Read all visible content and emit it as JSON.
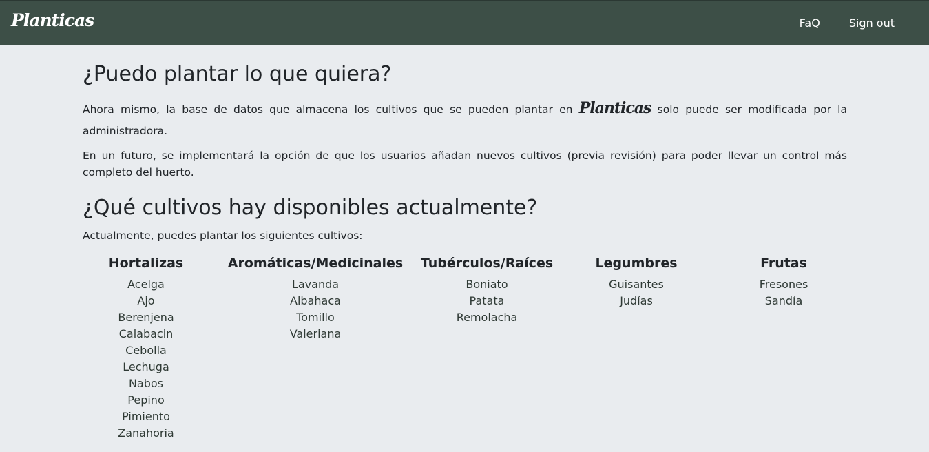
{
  "navbar": {
    "brand": "Planticas",
    "links": [
      {
        "label": "FaQ"
      },
      {
        "label": "Sign out"
      }
    ]
  },
  "main": {
    "heading1": "¿Puedo plantar lo que quiera?",
    "p1_before": "Ahora mismo, la base de datos que almacena los cultivos que se pueden plantar en ",
    "p1_brand": "Planticas",
    "p1_after": " solo puede ser modificada por la administradora.",
    "p2": "En un futuro, se implementará la opción de que los usuarios añadan nuevos cultivos (previa revisión) para poder llevar un control más completo del huerto.",
    "heading2": "¿Qué cultivos hay disponibles actualmente?",
    "p3": "Actualmente, puedes plantar los siguientes cultivos:",
    "categories": [
      {
        "title": "Hortalizas",
        "items": [
          "Acelga",
          "Ajo",
          "Berenjena",
          "Calabacin",
          "Cebolla",
          "Lechuga",
          "Nabos",
          "Pepino",
          "Pimiento",
          "Zanahoria"
        ]
      },
      {
        "title": "Aromáticas/Medicinales",
        "items": [
          "Lavanda",
          "Albahaca",
          "Tomillo",
          "Valeriana"
        ]
      },
      {
        "title": "Tubérculos/Raíces",
        "items": [
          "Boniato",
          "Patata",
          "Remolacha"
        ]
      },
      {
        "title": "Legumbres",
        "items": [
          "Guisantes",
          "Judías"
        ]
      },
      {
        "title": "Frutas",
        "items": [
          "Fresones",
          "Sandía"
        ]
      }
    ]
  }
}
